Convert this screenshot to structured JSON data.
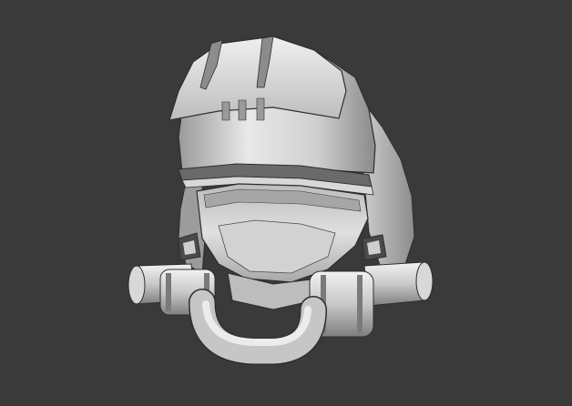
{
  "viewport": {
    "background": "#3a3a3a",
    "subject": "helmet-model",
    "material_colors": {
      "light": "#e6e6e6",
      "mid": "#c4c4c4",
      "shadow": "#8e8e8e",
      "dark": "#5a5a5a",
      "outline": "#2e2e2e"
    }
  }
}
